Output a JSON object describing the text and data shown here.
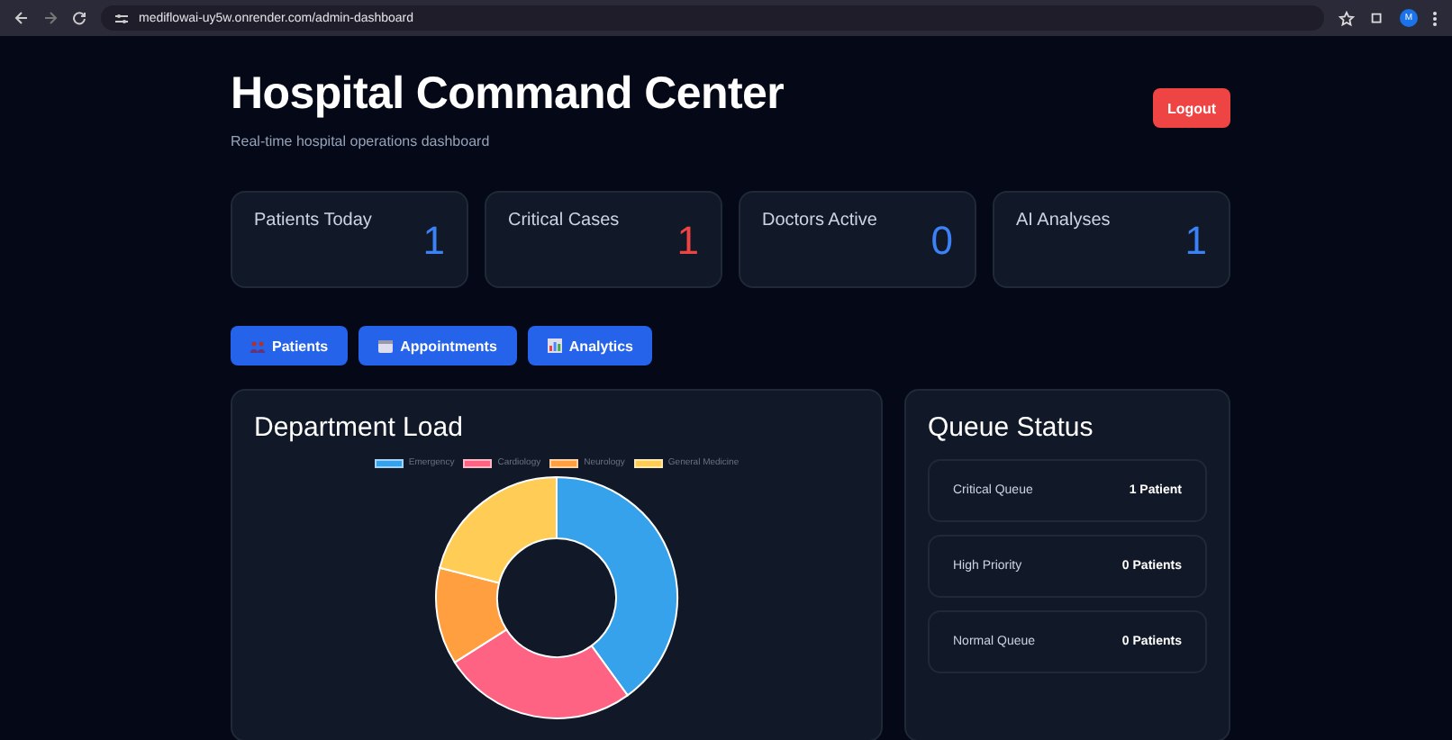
{
  "browser": {
    "url": "mediflowai-uy5w.onrender.com/admin-dashboard",
    "avatar": "M"
  },
  "header": {
    "title": "Hospital Command Center",
    "subtitle": "Real-time hospital operations dashboard",
    "logout": "Logout"
  },
  "stats": [
    {
      "label": "Patients Today",
      "value": "1",
      "color": "#3b82f6"
    },
    {
      "label": "Critical Cases",
      "value": "1",
      "color": "#ef4444"
    },
    {
      "label": "Doctors Active",
      "value": "0",
      "color": "#3b82f6"
    },
    {
      "label": "AI Analyses",
      "value": "1",
      "color": "#3b82f6"
    }
  ],
  "nav_buttons": [
    {
      "label": "Patients",
      "kind": "people"
    },
    {
      "label": "Appointments",
      "kind": "calendar"
    },
    {
      "label": "Analytics",
      "kind": "chart"
    }
  ],
  "department_load": {
    "title": "Department Load",
    "legend": [
      {
        "label": "Emergency",
        "color": "#36a2eb"
      },
      {
        "label": "Cardiology",
        "color": "#ff6384"
      },
      {
        "label": "Neurology",
        "color": "#ff9f40"
      },
      {
        "label": "General Medicine",
        "color": "#ffcd56"
      }
    ]
  },
  "queue_status": {
    "title": "Queue Status",
    "rows": [
      {
        "label": "Critical Queue",
        "count": "1 Patient"
      },
      {
        "label": "High Priority",
        "count": "0 Patients"
      },
      {
        "label": "Normal Queue",
        "count": "0 Patients"
      }
    ]
  }
}
